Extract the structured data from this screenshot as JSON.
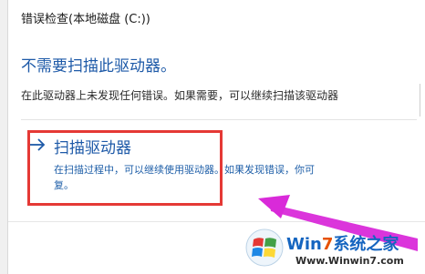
{
  "window": {
    "title": "错误检查(本地磁盘 (C:))"
  },
  "main": {
    "headline": "不需要扫描此驱动器。",
    "description": "在此驱动器上未发现任何错误。如果需要，可以继续扫描该驱动器"
  },
  "scan_option": {
    "title": "扫描驱动器",
    "description_line1": "在扫描过程中，可以继续使用驱动器。如果发现错误，你可",
    "description_line2": "复。",
    "icon": "right-arrow-icon"
  },
  "annotation": {
    "highlight_color": "#e53935",
    "arrow_color": "#d92ad9"
  },
  "watermark": {
    "brand_prefix": "Win",
    "brand_seven": "7",
    "brand_suffix": "系统之家",
    "url": "Www.Winwin7.com"
  },
  "colors": {
    "accent": "#1e5aa8"
  }
}
